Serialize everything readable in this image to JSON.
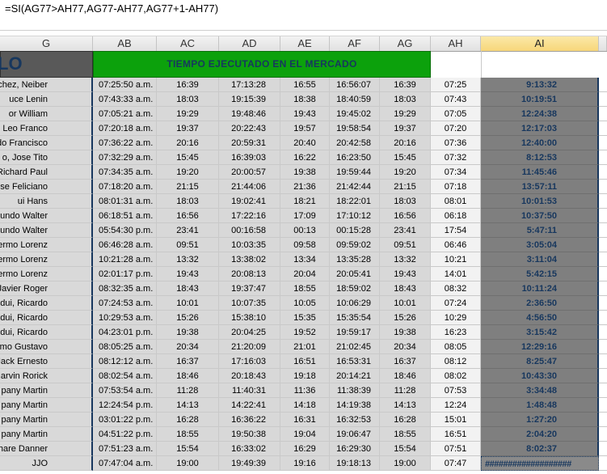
{
  "formula_bar": {
    "text": "=SI(AG77>AH77,AG77-AH77,AG77+1-AH77)"
  },
  "columns": [
    "G",
    "AB",
    "AC",
    "AD",
    "AE",
    "AF",
    "AG",
    "AH",
    "AI"
  ],
  "active_column": "AI",
  "title_row": {
    "g_fragment": "LO",
    "merged_title": "TIEMPO EJECUTADO EN EL MERCADO"
  },
  "rows": [
    {
      "g": "chez, Neiber",
      "ab": "07:25:50 a.m.",
      "ac": "16:39",
      "ad": "17:13:28",
      "ae": "16:55",
      "af": "16:56:07",
      "ag": "16:39",
      "ah": "07:25",
      "ai": "9:13:32"
    },
    {
      "g": "uce Lenin",
      "ab": "07:43:33 a.m.",
      "ac": "18:03",
      "ad": "19:15:39",
      "ae": "18:38",
      "af": "18:40:59",
      "ag": "18:03",
      "ah": "07:43",
      "ai": "10:19:51"
    },
    {
      "g": "or William",
      "ab": "07:05:21 a.m.",
      "ac": "19:29",
      "ad": "19:48:46",
      "ae": "19:43",
      "af": "19:45:02",
      "ag": "19:29",
      "ah": "07:05",
      "ai": "12:24:38"
    },
    {
      "g": "Leo Franco",
      "ab": "07:20:18 a.m.",
      "ac": "19:37",
      "ad": "20:22:43",
      "ae": "19:57",
      "af": "19:58:54",
      "ag": "19:37",
      "ah": "07:20",
      "ai": "12:17:03"
    },
    {
      "g": "gundo Francisco",
      "ab": "07:36:22 a.m.",
      "ac": "20:16",
      "ad": "20:59:31",
      "ae": "20:40",
      "af": "20:42:58",
      "ag": "20:16",
      "ah": "07:36",
      "ai": "12:40:00"
    },
    {
      "g": "o, Jose Tito",
      "ab": "07:32:29 a.m.",
      "ac": "15:45",
      "ad": "16:39:03",
      "ae": "16:22",
      "af": "16:23:50",
      "ag": "15:45",
      "ah": "07:32",
      "ai": "8:12:53"
    },
    {
      "g": "o, Richard Paul",
      "ab": "07:34:35 a.m.",
      "ac": "19:20",
      "ad": "20:00:57",
      "ae": "19:38",
      "af": "19:59:44",
      "ag": "19:20",
      "ah": "07:34",
      "ai": "11:45:46"
    },
    {
      "g": "Jose Feliciano",
      "ab": "07:18:20 a.m.",
      "ac": "21:15",
      "ad": "21:44:06",
      "ae": "21:36",
      "af": "21:42:44",
      "ag": "21:15",
      "ah": "07:18",
      "ai": "13:57:11"
    },
    {
      "g": "ui Hans",
      "ab": "08:01:31 a.m.",
      "ac": "18:03",
      "ad": "19:02:41",
      "ae": "18:21",
      "af": "18:22:01",
      "ag": "18:03",
      "ah": "08:01",
      "ai": "10:01:53"
    },
    {
      "g": "egundo Walter",
      "ab": "06:18:51 a.m.",
      "ac": "16:56",
      "ad": "17:22:16",
      "ae": "17:09",
      "af": "17:10:12",
      "ag": "16:56",
      "ah": "06:18",
      "ai": "10:37:50"
    },
    {
      "g": "egundo Walter",
      "ab": "05:54:30 p.m.",
      "ac": "23:41",
      "ad": "00:16:58",
      "ae": "00:13",
      "af": "00:15:28",
      "ag": "23:41",
      "ah": "17:54",
      "ai": "5:47:11"
    },
    {
      "g": "achi, Guillermo Lorenz",
      "ab": "06:46:28 a.m.",
      "ac": "09:51",
      "ad": "10:03:35",
      "ae": "09:58",
      "af": "09:59:02",
      "ag": "09:51",
      "ah": "06:46",
      "ai": "3:05:04"
    },
    {
      "g": "achi, Guillermo Lorenz",
      "ab": "10:21:28 a.m.",
      "ac": "13:32",
      "ad": "13:38:02",
      "ae": "13:34",
      "af": "13:35:28",
      "ag": "13:32",
      "ah": "10:21",
      "ai": "3:11:04"
    },
    {
      "g": "achi, Guillermo Lorenz",
      "ab": "02:01:17 p.m.",
      "ac": "19:43",
      "ad": "20:08:13",
      "ae": "20:04",
      "af": "20:05:41",
      "ag": "19:43",
      "ah": "14:01",
      "ai": "5:42:15"
    },
    {
      "g": "uez, Javier Roger",
      "ab": "08:32:35 a.m.",
      "ac": "18:43",
      "ad": "19:37:47",
      "ae": "18:55",
      "af": "18:59:02",
      "ag": "18:43",
      "ah": "08:32",
      "ai": "10:11:24"
    },
    {
      "g": "dui, Ricardo",
      "ab": "07:24:53 a.m.",
      "ac": "10:01",
      "ad": "10:07:35",
      "ae": "10:05",
      "af": "10:06:29",
      "ag": "10:01",
      "ah": "07:24",
      "ai": "2:36:50"
    },
    {
      "g": "dui, Ricardo",
      "ab": "10:29:53 a.m.",
      "ac": "15:26",
      "ad": "15:38:10",
      "ae": "15:35",
      "af": "15:35:54",
      "ag": "15:26",
      "ah": "10:29",
      "ai": "4:56:50"
    },
    {
      "g": "dui, Ricardo",
      "ab": "04:23:01 p.m.",
      "ac": "19:38",
      "ad": "20:04:25",
      "ae": "19:52",
      "af": "19:59:17",
      "ag": "19:38",
      "ah": "16:23",
      "ai": "3:15:42"
    },
    {
      "g": "Elmo Gustavo",
      "ab": "08:05:25 a.m.",
      "ac": "20:34",
      "ad": "21:20:09",
      "ae": "21:01",
      "af": "21:02:45",
      "ag": "20:34",
      "ah": "08:05",
      "ai": "12:29:16"
    },
    {
      "g": "s, Jimy Jack Ernesto",
      "ab": "08:12:12 a.m.",
      "ac": "16:37",
      "ad": "17:16:03",
      "ae": "16:51",
      "af": "16:53:31",
      "ag": "16:37",
      "ah": "08:12",
      "ai": "8:25:47"
    },
    {
      "g": "Marvin Rorick",
      "ab": "08:02:54 a.m.",
      "ac": "18:46",
      "ad": "20:18:43",
      "ae": "19:18",
      "af": "20:14:21",
      "ag": "18:46",
      "ah": "08:02",
      "ai": "10:43:30"
    },
    {
      "g": "pany Martin",
      "ab": "07:53:54 a.m.",
      "ac": "11:28",
      "ad": "11:40:31",
      "ae": "11:36",
      "af": "11:38:39",
      "ag": "11:28",
      "ah": "07:53",
      "ai": "3:34:48"
    },
    {
      "g": "pany Martin",
      "ab": "12:24:54 p.m.",
      "ac": "14:13",
      "ad": "14:22:41",
      "ae": "14:18",
      "af": "14:19:38",
      "ag": "14:13",
      "ah": "12:24",
      "ai": "1:48:48"
    },
    {
      "g": "pany Martin",
      "ab": "03:01:22 p.m.",
      "ac": "16:28",
      "ad": "16:36:22",
      "ae": "16:31",
      "af": "16:32:53",
      "ag": "16:28",
      "ah": "15:01",
      "ai": "1:27:20"
    },
    {
      "g": "pany Martin",
      "ab": "04:51:22 p.m.",
      "ac": "18:55",
      "ad": "19:50:38",
      "ae": "19:04",
      "af": "19:06:47",
      "ag": "18:55",
      "ah": "16:51",
      "ai": "2:04:20"
    },
    {
      "g": "na, Richare Danner",
      "ab": "07:51:23 a.m.",
      "ac": "15:54",
      "ad": "16:33:02",
      "ae": "16:29",
      "af": "16:29:30",
      "ag": "15:54",
      "ah": "07:51",
      "ai": "8:02:37"
    },
    {
      "g": "JJO",
      "ab": "07:47:04 a.m.",
      "ac": "19:00",
      "ad": "19:49:39",
      "ae": "19:16",
      "af": "19:18:13",
      "ag": "19:00",
      "ah": "07:47",
      "ai": "###################"
    }
  ]
}
